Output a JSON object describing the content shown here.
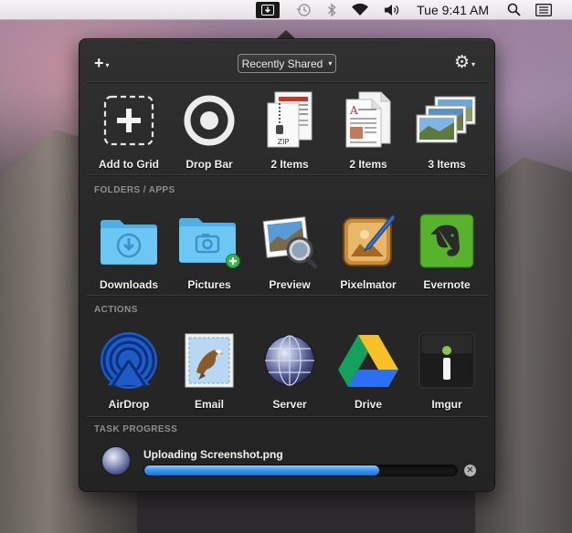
{
  "menubar": {
    "time": "Tue 9:41 AM",
    "icons": [
      "dropzone-menubar-icon",
      "time-machine-icon",
      "bluetooth-icon",
      "wifi-icon",
      "volume-icon",
      "spotlight-icon",
      "notification-center-icon"
    ]
  },
  "toolbar": {
    "add_symbol": "+",
    "dropdown_label": "Recently Shared",
    "dropdown_caret": "▾",
    "gear_symbol": "⚙",
    "caret": "▾"
  },
  "grid": {
    "items": [
      {
        "label": "Add to Grid",
        "icon": "add-to-grid-icon"
      },
      {
        "label": "Drop Bar",
        "icon": "drop-bar-icon"
      },
      {
        "label": "2 Items",
        "icon": "documents-stack-icon"
      },
      {
        "label": "2 Items",
        "icon": "documents-stack-icon"
      },
      {
        "label": "3 Items",
        "icon": "photos-stack-icon"
      }
    ]
  },
  "folders_apps": {
    "title": "FOLDERS / APPS",
    "items": [
      {
        "label": "Downloads",
        "icon": "downloads-folder-icon"
      },
      {
        "label": "Pictures",
        "icon": "pictures-folder-icon"
      },
      {
        "label": "Preview",
        "icon": "preview-app-icon"
      },
      {
        "label": "Pixelmator",
        "icon": "pixelmator-app-icon"
      },
      {
        "label": "Evernote",
        "icon": "evernote-app-icon"
      }
    ]
  },
  "actions": {
    "title": "ACTIONS",
    "items": [
      {
        "label": "AirDrop",
        "icon": "airdrop-icon"
      },
      {
        "label": "Email",
        "icon": "email-icon"
      },
      {
        "label": "Server",
        "icon": "server-icon"
      },
      {
        "label": "Drive",
        "icon": "google-drive-icon"
      },
      {
        "label": "Imgur",
        "icon": "imgur-icon"
      }
    ]
  },
  "task_progress": {
    "title": "TASK PROGRESS",
    "task_label": "Uploading Screenshot.png",
    "progress": 0.75,
    "cancel_symbol": "✕"
  },
  "colors": {
    "progress_fill": "#3d98f3",
    "evernote_green": "#57b22c",
    "folder_blue": "#5fc0f2",
    "imgur_green": "#8bc34a"
  }
}
